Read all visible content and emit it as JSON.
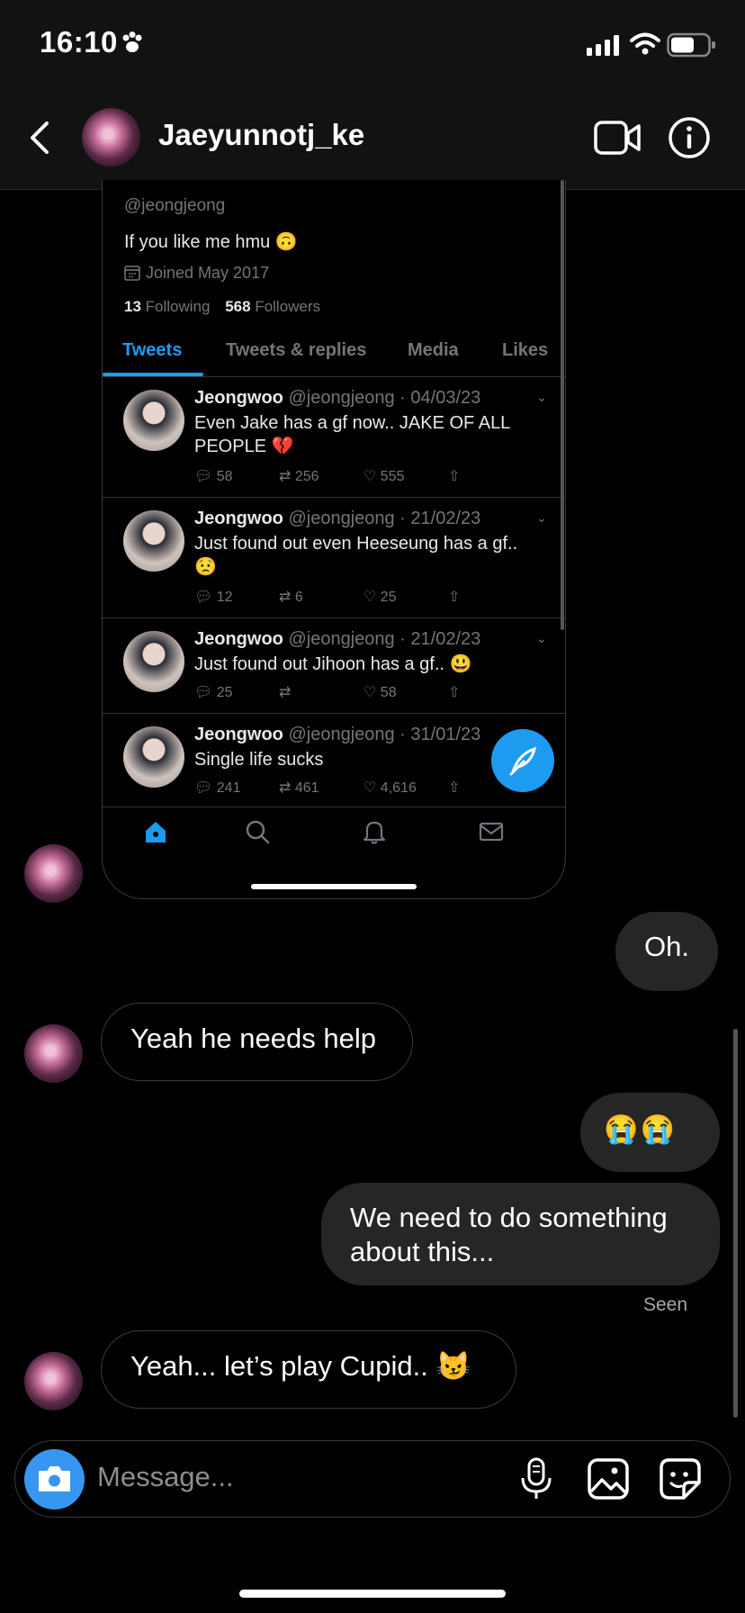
{
  "status_bar": {
    "time": "16:10"
  },
  "header": {
    "username": "Jaeyunnotj_ke"
  },
  "shared_screenshot": {
    "handle": "@jeongjeong",
    "bio": "If you like me hmu",
    "bio_emoji": "🙃",
    "joined": "Joined May 2017",
    "following_count": "13",
    "following_label": "Following",
    "followers_count": "568",
    "followers_label": "Followers",
    "tabs": [
      {
        "label": "Tweets",
        "active": true
      },
      {
        "label": "Tweets & replies",
        "active": false
      },
      {
        "label": "Media",
        "active": false
      },
      {
        "label": "Likes",
        "active": false
      }
    ],
    "tweets": [
      {
        "name": "Jeongwoo",
        "meta": "@jeongjeong · 04/03/23",
        "text": "Even Jake has a gf now.. JAKE OF ALL PEOPLE 💔",
        "replies": "58",
        "retweets": "256",
        "likes": "555"
      },
      {
        "name": "Jeongwoo",
        "meta": "@jeongjeong · 21/02/23",
        "text": "Just found out even Heeseung has a gf.. 😟",
        "replies": "12",
        "retweets": "6",
        "likes": "25"
      },
      {
        "name": "Jeongwoo",
        "meta": "@jeongjeong · 21/02/23",
        "text": "Just found out Jihoon has a gf.. 😃",
        "replies": "25",
        "retweets": "",
        "likes": "58"
      },
      {
        "name": "Jeongwoo",
        "meta": "@jeongjeong · 31/01/23",
        "text": "Single life sucks",
        "replies": "241",
        "retweets": "461",
        "likes": "4,616"
      }
    ]
  },
  "messages": [
    {
      "from": "me",
      "text": "Oh."
    },
    {
      "from": "them",
      "text": "Yeah he needs help"
    },
    {
      "from": "me",
      "text": "😭😭"
    },
    {
      "from": "me",
      "text": "We need to do something about this..."
    },
    {
      "from": "them",
      "text": "Yeah... let’s play Cupid.. 😼"
    }
  ],
  "seen_label": "Seen",
  "composer": {
    "placeholder": "Message..."
  },
  "colors": {
    "twitter_blue": "#1d9bf0",
    "instagram_blue": "#3797f0",
    "bubble_out": "#262626"
  }
}
